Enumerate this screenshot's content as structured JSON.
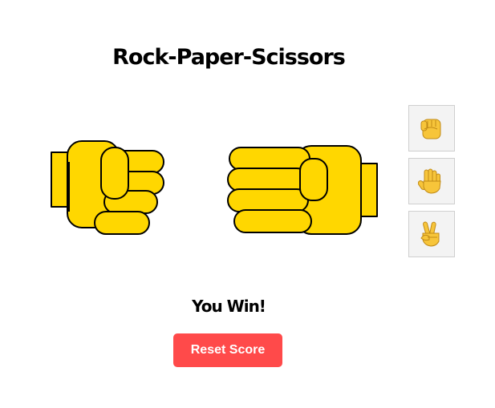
{
  "game": {
    "title": "Rock-Paper-Scissors",
    "result": "You Win!",
    "reset_label": "Reset Score",
    "player_hand": "rock-hand-icon",
    "computer_hand": "rock-hand-icon"
  },
  "choices": [
    {
      "name": "rock",
      "icon": "raised-fist-icon"
    },
    {
      "name": "paper",
      "icon": "raised-hand-icon"
    },
    {
      "name": "scissors",
      "icon": "victory-hand-icon"
    }
  ],
  "colors": {
    "hand_fill": "#ffd700",
    "hand_stroke": "#000000",
    "reset_button": "#ff4a4a",
    "choice_bg": "#f3f3f3",
    "choice_border": "#cfcfcf",
    "emoji_skin": "#f7c53a"
  }
}
